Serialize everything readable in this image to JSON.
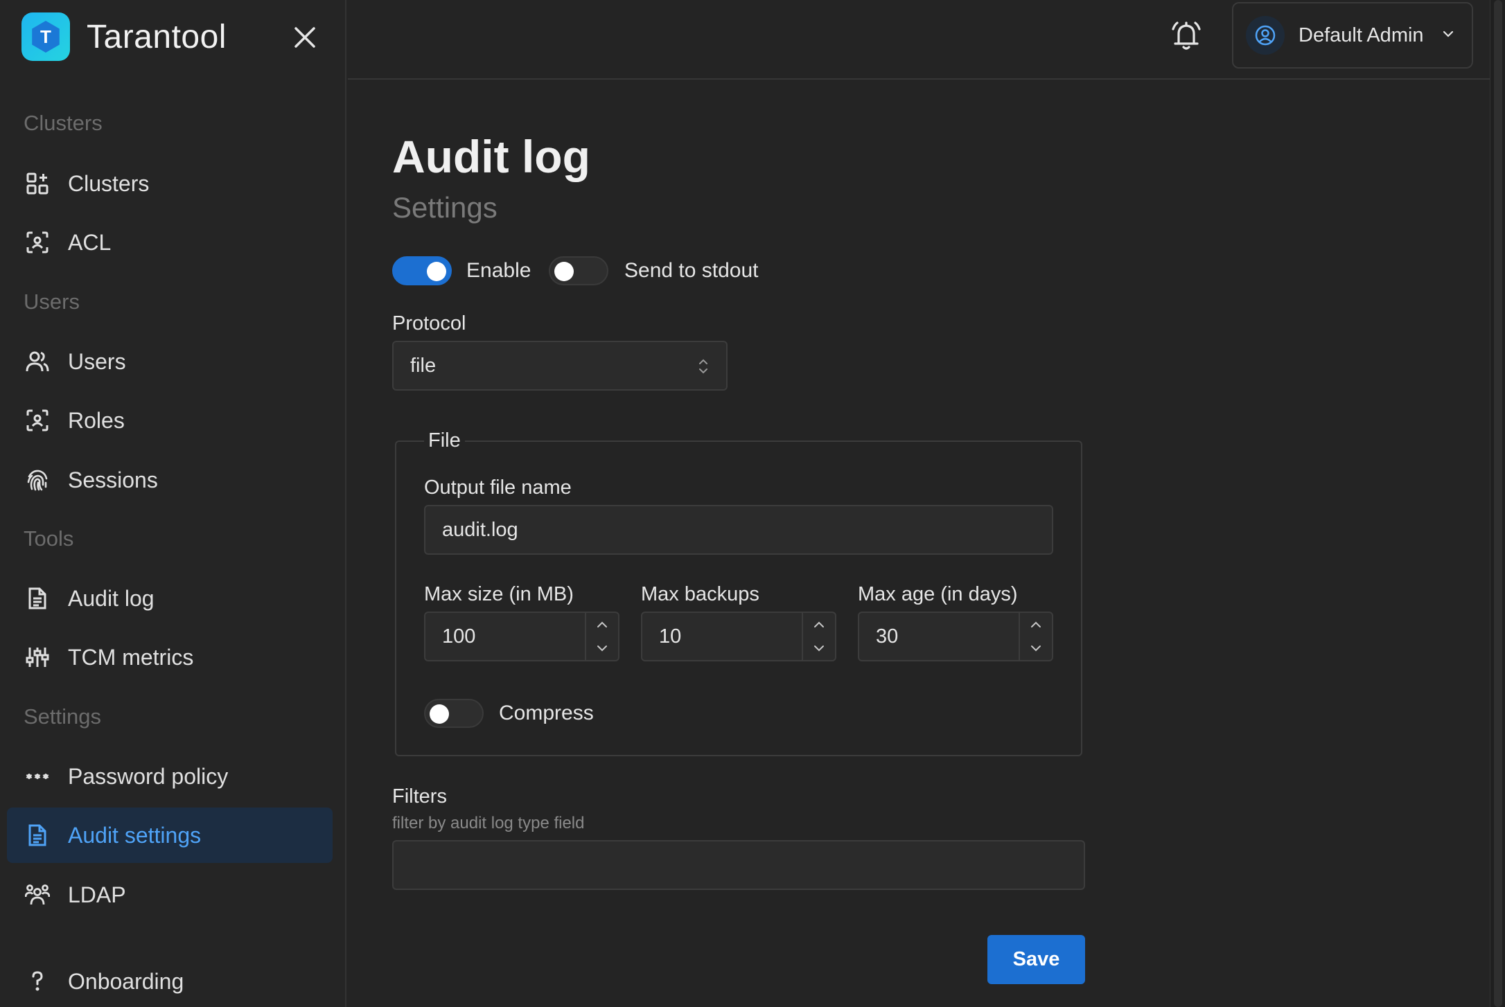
{
  "app": {
    "brand": "Tarantool",
    "logo_letter": "T"
  },
  "sidebar": {
    "sections": [
      {
        "title": "Clusters",
        "items": [
          {
            "label": "Clusters",
            "icon": "clusters-icon"
          },
          {
            "label": "ACL",
            "icon": "acl-icon"
          }
        ]
      },
      {
        "title": "Users",
        "items": [
          {
            "label": "Users",
            "icon": "users-icon"
          },
          {
            "label": "Roles",
            "icon": "roles-icon"
          },
          {
            "label": "Sessions",
            "icon": "fingerprint-icon"
          }
        ]
      },
      {
        "title": "Tools",
        "items": [
          {
            "label": "Audit log",
            "icon": "document-icon"
          },
          {
            "label": "TCM metrics",
            "icon": "sliders-icon"
          }
        ]
      },
      {
        "title": "Settings",
        "items": [
          {
            "label": "Password policy",
            "icon": "password-icon"
          },
          {
            "label": "Audit settings",
            "icon": "document-icon",
            "active": true
          },
          {
            "label": "LDAP",
            "icon": "group-icon"
          }
        ]
      }
    ],
    "footer_item": {
      "label": "Onboarding",
      "icon": "question-icon"
    }
  },
  "topbar": {
    "user_name": "Default Admin"
  },
  "page": {
    "title": "Audit log",
    "subtitle": "Settings",
    "enable": {
      "label": "Enable",
      "on": true
    },
    "stdout": {
      "label": "Send to stdout",
      "on": false
    },
    "protocol": {
      "label": "Protocol",
      "value": "file"
    },
    "file_group": {
      "legend": "File",
      "output_label": "Output file name",
      "output_value": "audit.log",
      "max_size": {
        "label": "Max size (in MB)",
        "value": "100"
      },
      "max_backups": {
        "label": "Max backups",
        "value": "10"
      },
      "max_age": {
        "label": "Max age (in days)",
        "value": "30"
      },
      "compress": {
        "label": "Compress",
        "on": false
      }
    },
    "filters": {
      "label": "Filters",
      "hint": "filter by audit log type field",
      "value": ""
    },
    "save_label": "Save"
  },
  "colors": {
    "accent": "#1c6fd1",
    "active_text": "#4fa3f7",
    "active_bg": "#1c2d42",
    "background": "#242424"
  }
}
